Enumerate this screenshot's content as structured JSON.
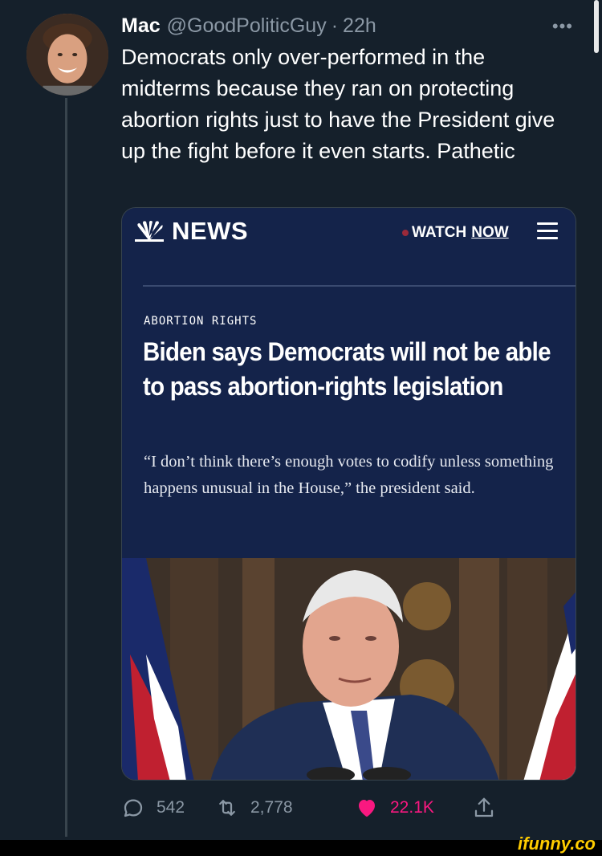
{
  "tweet": {
    "name": "Mac",
    "handle": "@GoodPoliticGuy",
    "separator": "·",
    "time": "22h",
    "more": "•••",
    "text": "Democrats only over-performed in the midterms because they ran on protecting abortion rights just to have the President give up the fight before it even starts. Pathetic"
  },
  "card": {
    "brand": "NEWS",
    "watch_label": "WATCH",
    "now_label": "NOW",
    "category": "ABORTION RIGHTS",
    "headline": "Biden says Democrats will not be able to pass abortion-rights legislation",
    "quote": "“I don’t think there’s enough votes to codify unless something happens unusual in the House,” the president said."
  },
  "actions": {
    "replies": "542",
    "retweets": "2,778",
    "likes": "22.1K"
  },
  "watermark": "ifunny.co",
  "colors": {
    "background": "#15202b",
    "card_bg": "#14234a",
    "like": "#f91880",
    "muted": "#8b98a5"
  }
}
